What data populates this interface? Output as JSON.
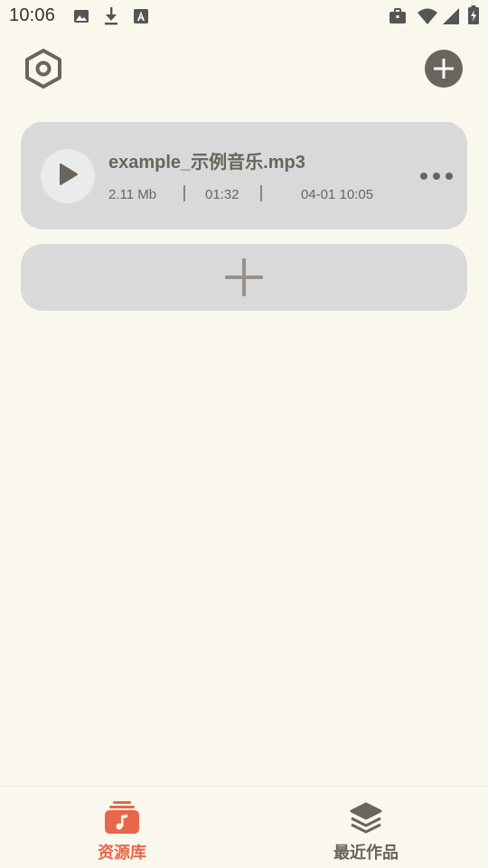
{
  "status_bar": {
    "time": "10:06",
    "left_icons": [
      "image-icon",
      "download-icon",
      "text-a-icon"
    ],
    "right_icons": [
      "briefcase-icon",
      "wifi-icon",
      "signal-icon",
      "battery-charging-icon"
    ]
  },
  "header": {
    "settings_icon": "hexagon-settings-icon",
    "add_icon": "add-circle-icon"
  },
  "tracks": [
    {
      "name": "example_示例音乐.mp3",
      "size": "2.11 Mb",
      "duration": "01:32",
      "date": "04-01 10:05"
    }
  ],
  "add_card": {
    "icon": "plus-icon"
  },
  "bottom_nav": {
    "items": [
      {
        "label": "资源库",
        "icon": "music-library-icon",
        "active": true
      },
      {
        "label": "最近作品",
        "icon": "layers-icon",
        "active": false
      }
    ]
  },
  "colors": {
    "background": "#faf7ec",
    "card": "#d9d9d9",
    "text": "#6b645c",
    "accent": "#e8674a"
  }
}
